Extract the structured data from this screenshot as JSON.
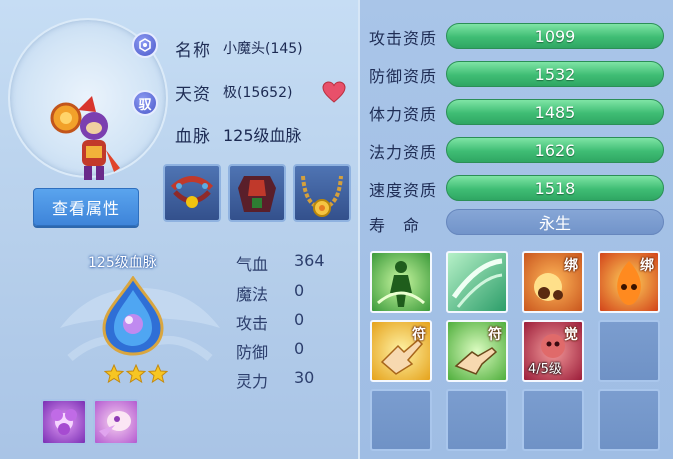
{
  "pet": {
    "name_label": "名称",
    "name_value": "小魔头(145)",
    "talent_label": "天资",
    "talent_value": "极(15652)",
    "bloodline_label": "血脉",
    "bloodline_value": "125级血脉",
    "bind_badge": "驭",
    "view_attributes_button": "查看属性"
  },
  "bloodline_panel": {
    "title": "125级血脉",
    "stars": 3
  },
  "attributes": [
    {
      "label": "气血",
      "value": "364"
    },
    {
      "label": "魔法",
      "value": "0"
    },
    {
      "label": "攻击",
      "value": "0"
    },
    {
      "label": "防御",
      "value": "0"
    },
    {
      "label": "灵力",
      "value": "30"
    }
  ],
  "aptitudes": [
    {
      "label": "攻击资质",
      "value": "1099"
    },
    {
      "label": "防御资质",
      "value": "1532"
    },
    {
      "label": "体力资质",
      "value": "1485"
    },
    {
      "label": "法力资质",
      "value": "1626"
    },
    {
      "label": "速度资质",
      "value": "1518"
    }
  ],
  "lifespan": {
    "label": "寿　命",
    "value": "永生"
  },
  "skills": [
    {
      "tag": "",
      "level": ""
    },
    {
      "tag": "",
      "level": ""
    },
    {
      "tag": "绑",
      "level": ""
    },
    {
      "tag": "绑",
      "level": ""
    },
    {
      "tag": "符",
      "level": ""
    },
    {
      "tag": "符",
      "level": ""
    },
    {
      "tag": "觉",
      "level": "4/5级"
    }
  ],
  "colors": {
    "aptitude_bar": "#3fbd74",
    "button": "#4a92e4",
    "heart": "#e8506a"
  },
  "icons": {
    "name_badge": "emblem-icon",
    "equipment": [
      "collar-icon",
      "armor-icon",
      "necklace-icon"
    ],
    "heart": "heart-icon"
  }
}
